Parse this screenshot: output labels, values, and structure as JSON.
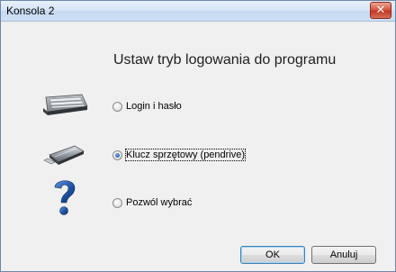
{
  "window": {
    "title": "Konsola 2",
    "close_symbol": "✕"
  },
  "dialog": {
    "heading": "Ustaw tryb logowania do programu",
    "options": [
      {
        "label": "Login i hasło",
        "icon": "keyboard-icon",
        "selected": false
      },
      {
        "label": "Klucz sprzętowy (pendrive)",
        "icon": "usb-drive-icon",
        "selected": true
      },
      {
        "label": "Pozwól wybrać",
        "icon": "question-mark-icon",
        "selected": false
      }
    ],
    "buttons": {
      "ok": "OK",
      "cancel": "Anuluj"
    }
  },
  "colors": {
    "question_mark": "#1c4fa0",
    "close_button": "#c23520"
  }
}
